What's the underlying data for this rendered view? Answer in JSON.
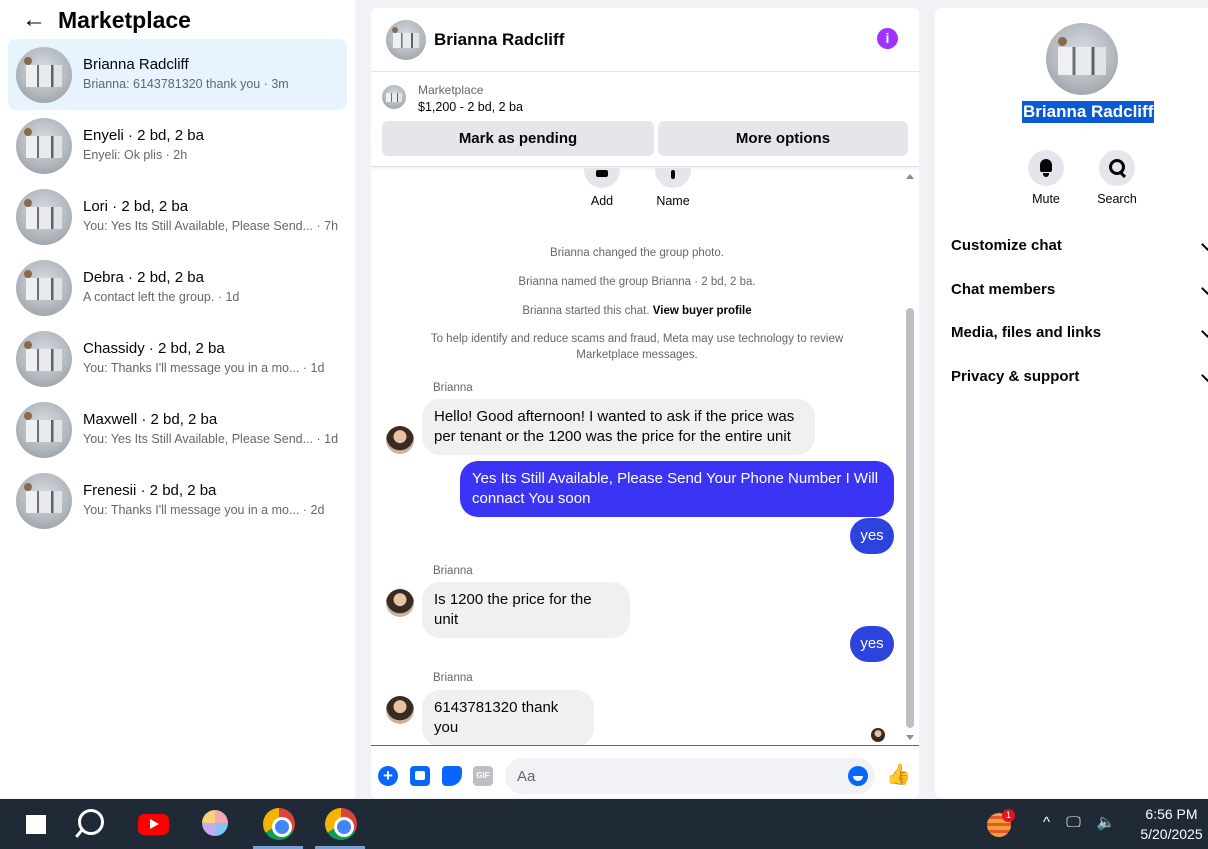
{
  "sidebar": {
    "back_arrow": "←",
    "title": "Marketplace",
    "conversations": [
      {
        "name": "Brianna Radcliff",
        "snippet": "Brianna: 6143781320 thank you · 3m"
      },
      {
        "name": "Enyeli · 2 bd, 2 ba",
        "snippet": "Enyeli: Ok plis · 2h"
      },
      {
        "name": "Lori · 2 bd, 2 ba",
        "snippet": "You: Yes Its Still Available, Please Send... · 7h"
      },
      {
        "name": "Debra · 2 bd, 2 ba",
        "snippet": "A contact left the group. · 1d"
      },
      {
        "name": "Chassidy · 2 bd, 2 ba",
        "snippet": "You: Thanks I'll message you in a mo... · 1d"
      },
      {
        "name": "Maxwell · 2 bd, 2 ba",
        "snippet": "You: Yes Its Still Available, Please Send... · 1d"
      },
      {
        "name": "Frenesii · 2 bd, 2 ba",
        "snippet": "You: Thanks I'll message you in a mo... · 2d"
      }
    ]
  },
  "chat": {
    "name": "Brianna Radcliff",
    "info_icon": "i",
    "listing": {
      "category": "Marketplace",
      "title": "$1,200 - 2 bd, 2 ba"
    },
    "buttons": {
      "pending": "Mark as pending",
      "more": "More options"
    },
    "top_actions": {
      "add": "Add",
      "name": "Name"
    },
    "system": {
      "photo": "Brianna changed the group photo.",
      "named": "Brianna named the group Brianna · 2 bd, 2 ba.",
      "started": "Brianna started this chat.",
      "view_profile": "View buyer profile",
      "scam_notice": "To help identify and reduce scams and fraud, Meta may use technology to review Marketplace messages."
    },
    "sender": "Brianna",
    "messages": {
      "m1": "Hello! Good afternoon! I wanted to ask if the price was per tenant or the 1200 was the price for the entire unit",
      "m2": "Yes Its Still Available, Please Send Your Phone Number I Will connact You soon",
      "m3": "yes",
      "m4": "Is 1200 the price for the unit",
      "m5": "yes",
      "m6": "6143781320 thank you"
    },
    "composer": {
      "placeholder": "Aa",
      "gif": "GIF",
      "plus": "+",
      "like": "👍"
    }
  },
  "right_panel": {
    "name": "Brianna Radcliff",
    "actions": {
      "mute": "Mute",
      "search": "Search"
    },
    "sections": [
      "Customize chat",
      "Chat members",
      "Media, files and links",
      "Privacy & support"
    ]
  },
  "taskbar": {
    "tray": "^ 🖵 🔈",
    "time": "6:56 PM",
    "date": "5/20/2025"
  },
  "colors": {
    "accent": "#0866ff",
    "outgoing_bubble": "#3c34f5",
    "info": "#a033ff",
    "selected": "#e7f3ff",
    "taskbar": "#1f2a36"
  }
}
